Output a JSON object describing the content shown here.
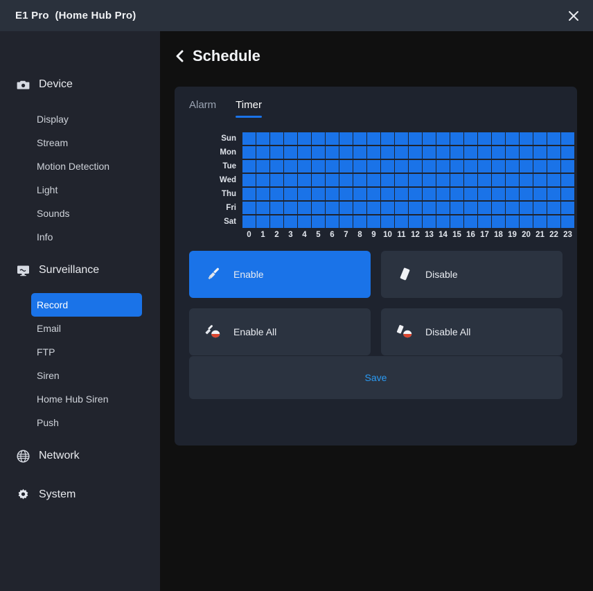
{
  "window": {
    "title": "E1 Pro  (Home Hub Pro)",
    "close_icon": "close-icon",
    "titlebar_color": "#2a313c"
  },
  "sidebar": {
    "background": "#21242d",
    "groups": [
      {
        "label": "Device",
        "icon": "camera-icon",
        "items": [
          {
            "label": "Display",
            "selected": false
          },
          {
            "label": "Stream",
            "selected": false
          },
          {
            "label": "Motion Detection",
            "selected": false
          },
          {
            "label": "Light",
            "selected": false
          },
          {
            "label": "Sounds",
            "selected": false
          },
          {
            "label": "Info",
            "selected": false
          }
        ]
      },
      {
        "label": "Surveillance",
        "icon": "monitor-icon",
        "items": [
          {
            "label": "Record",
            "selected": true
          },
          {
            "label": "Email",
            "selected": false
          },
          {
            "label": "FTP",
            "selected": false
          },
          {
            "label": "Siren",
            "selected": false
          },
          {
            "label": "Home Hub Siren",
            "selected": false
          },
          {
            "label": "Push",
            "selected": false
          }
        ]
      },
      {
        "label": "Network",
        "icon": "globe-icon",
        "items": []
      },
      {
        "label": "System",
        "icon": "gear-icon",
        "items": []
      }
    ],
    "selected_color": "#1a73e8"
  },
  "page": {
    "title": "Schedule",
    "back_icon": "chevron-left-icon",
    "background": "#101010"
  },
  "card": {
    "background": "#1e232e"
  },
  "tabs": [
    {
      "label": "Alarm",
      "active": false
    },
    {
      "label": "Timer",
      "active": true
    }
  ],
  "schedule": {
    "days": [
      "Sun",
      "Mon",
      "Tue",
      "Wed",
      "Thu",
      "Fri",
      "Sat"
    ],
    "hours": [
      "0",
      "1",
      "2",
      "3",
      "4",
      "5",
      "6",
      "7",
      "8",
      "9",
      "10",
      "11",
      "12",
      "13",
      "14",
      "15",
      "16",
      "17",
      "18",
      "19",
      "20",
      "21",
      "22",
      "23"
    ],
    "cell_on_color": "#1a73e8",
    "cell_off_color": "#1e232e",
    "grid": [
      [
        1,
        1,
        1,
        1,
        1,
        1,
        1,
        1,
        1,
        1,
        1,
        1,
        1,
        1,
        1,
        1,
        1,
        1,
        1,
        1,
        1,
        1,
        1,
        1
      ],
      [
        1,
        1,
        1,
        1,
        1,
        1,
        1,
        1,
        1,
        1,
        1,
        1,
        1,
        1,
        1,
        1,
        1,
        1,
        1,
        1,
        1,
        1,
        1,
        1
      ],
      [
        1,
        1,
        1,
        1,
        1,
        1,
        1,
        1,
        1,
        1,
        1,
        1,
        1,
        1,
        1,
        1,
        1,
        1,
        1,
        1,
        1,
        1,
        1,
        1
      ],
      [
        1,
        1,
        1,
        1,
        1,
        1,
        1,
        1,
        1,
        1,
        1,
        1,
        1,
        1,
        1,
        1,
        1,
        1,
        1,
        1,
        1,
        1,
        1,
        1
      ],
      [
        1,
        1,
        1,
        1,
        1,
        1,
        1,
        1,
        1,
        1,
        1,
        1,
        1,
        1,
        1,
        1,
        1,
        1,
        1,
        1,
        1,
        1,
        1,
        1
      ],
      [
        1,
        1,
        1,
        1,
        1,
        1,
        1,
        1,
        1,
        1,
        1,
        1,
        1,
        1,
        1,
        1,
        1,
        1,
        1,
        1,
        1,
        1,
        1,
        1
      ],
      [
        1,
        1,
        1,
        1,
        1,
        1,
        1,
        1,
        1,
        1,
        1,
        1,
        1,
        1,
        1,
        1,
        1,
        1,
        1,
        1,
        1,
        1,
        1,
        1
      ]
    ]
  },
  "actions": [
    {
      "label": "Enable",
      "icon": "brush-icon",
      "active": true
    },
    {
      "label": "Disable",
      "icon": "eraser-icon",
      "active": false
    },
    {
      "label": "Enable All",
      "icon": "brush-fill-icon",
      "active": false
    },
    {
      "label": "Disable All",
      "icon": "eraser-fill-icon",
      "active": false
    }
  ],
  "save": {
    "label": "Save",
    "color": "#2b9bf4"
  }
}
